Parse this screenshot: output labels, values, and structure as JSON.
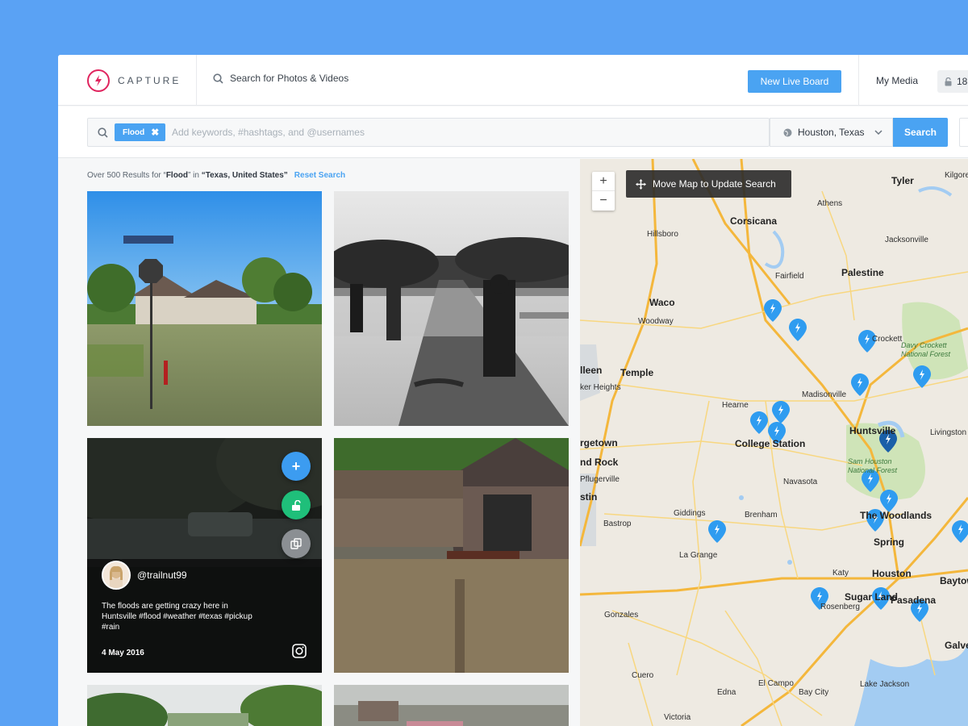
{
  "brand": {
    "name": "CAPTURE"
  },
  "header": {
    "search_label": "Search for Photos & Videos",
    "new_board_label": "New Live Board",
    "my_media_label": "My Media",
    "lock_count": "18"
  },
  "search": {
    "tag": "Flood",
    "placeholder": "Add keywords, #hashtags, and @usernames",
    "location": "Houston, Texas",
    "button_label": "Search"
  },
  "results": {
    "prefix": "Over 500 Results for “",
    "query": "Flood",
    "middle": "” in ",
    "place": "“Texas, United States”",
    "reset_label": "Reset Search"
  },
  "post": {
    "add_symbol": "+",
    "handle": "@trailnut99",
    "caption": "The floods are getting crazy here in Huntsville #flood #weather #texas #pickup #rain",
    "date": "4 May 2016"
  },
  "map": {
    "zoom_in": "+",
    "zoom_out": "−",
    "move_tip": "Move Map to Update Search",
    "cities": [
      "Tyler",
      "Kilgore",
      "Athens",
      "Corsicana",
      "Hillsboro",
      "Jacksonville",
      "Fairfield",
      "Palestine",
      "Waco",
      "Woodway",
      "Crockett",
      "Davy Crockett National Forest",
      "Temple",
      "lleen",
      "ker Heights",
      "Madisonville",
      "Hearne",
      "Huntsville",
      "Livingston",
      "College Station",
      "rgetown",
      "nd Rock",
      "Pflugerville",
      "stin",
      "Navasota",
      "Sam Houston National Forest",
      "Giddings",
      "Brenham",
      "The Woodlands",
      "Bastrop",
      "La Grange",
      "Spring",
      "Katy",
      "Houston",
      "Baytown",
      "Gonzales",
      "Sugar Land",
      "Pasadena",
      "Rosenberg",
      "El Campo",
      "Cuero",
      "Galve",
      "Edna",
      "Bay City",
      "Lake Jackson",
      "Victoria"
    ]
  }
}
